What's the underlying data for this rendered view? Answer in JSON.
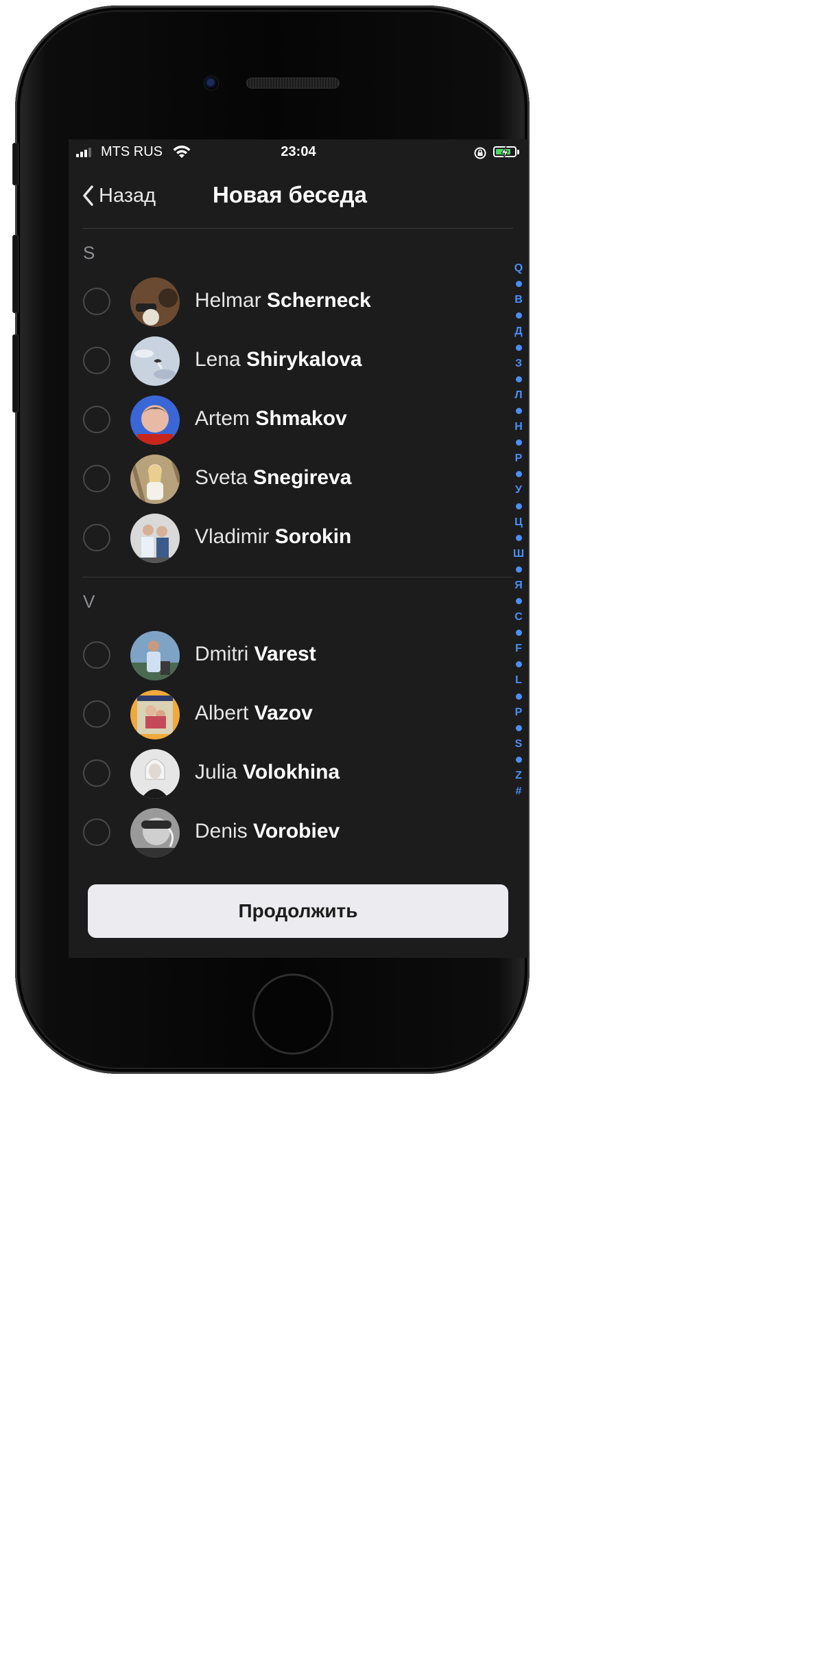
{
  "status_bar": {
    "carrier": "MTS RUS",
    "time": "23:04",
    "battery_level": 0.8,
    "battery_color": "#4cd964"
  },
  "nav": {
    "back_label": "Назад",
    "title": "Новая беседа"
  },
  "sections": [
    {
      "letter": "S",
      "contacts": [
        {
          "first": "Helmar",
          "last": "Scherneck",
          "avatar_bg": "#6b4a32"
        },
        {
          "first": "Lena",
          "last": "Shirykalova",
          "avatar_bg": "#c9d3e0"
        },
        {
          "first": "Artem",
          "last": "Shmakov",
          "avatar_bg": "#3b66d6"
        },
        {
          "first": "Sveta",
          "last": "Snegireva",
          "avatar_bg": "#b8a27c"
        },
        {
          "first": "Vladimir",
          "last": "Sorokin",
          "avatar_bg": "#d9d9d9"
        }
      ]
    },
    {
      "letter": "V",
      "contacts": [
        {
          "first": "Dmitri",
          "last": "Varest",
          "avatar_bg": "#7fa3c4"
        },
        {
          "first": "Albert",
          "last": "Vazov",
          "avatar_bg": "#f0a93c"
        },
        {
          "first": "Julia",
          "last": "Volokhina",
          "avatar_bg": "#e6e6e6"
        },
        {
          "first": "Denis",
          "last": "Vorobiev",
          "avatar_bg": "#9a9a9a"
        }
      ]
    }
  ],
  "index": [
    "Q",
    "•",
    "В",
    "•",
    "Д",
    "•",
    "З",
    "•",
    "Л",
    "•",
    "Н",
    "•",
    "Р",
    "•",
    "У",
    "•",
    "Ц",
    "•",
    "Ш",
    "•",
    "Я",
    "•",
    "C",
    "•",
    "F",
    "•",
    "L",
    "•",
    "P",
    "•",
    "S",
    "•",
    "Z",
    "#"
  ],
  "continue_label": "Продолжить",
  "colors": {
    "accent": "#4a8ff8",
    "screen_bg": "#1c1c1d",
    "button_bg": "#ececf0"
  }
}
